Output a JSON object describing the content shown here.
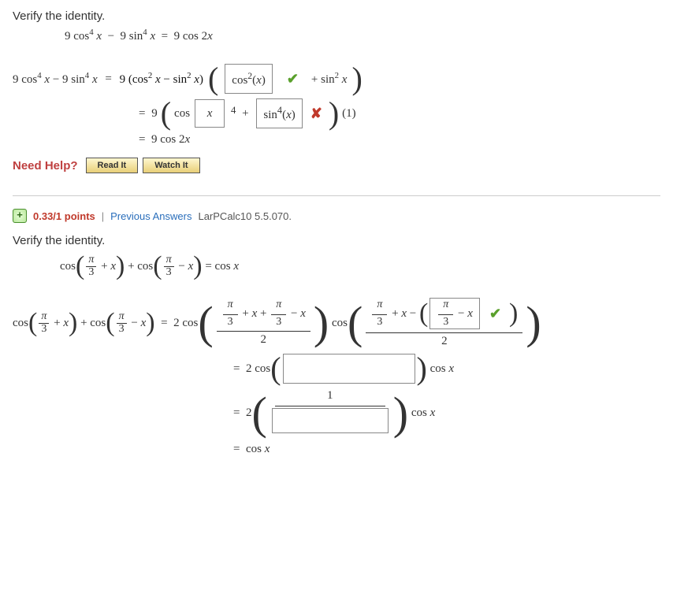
{
  "q1": {
    "prompt": "Verify the identity.",
    "identity_lhs": "9 cos⁴ x − 9 sin⁴ x",
    "identity_rhs": "9 cos 2x",
    "step1_left": "9 cos⁴ x − 9 sin⁴ x",
    "step1_right_prefix": "9 (cos² x − sin² x)",
    "input1_value": "cos²(x)",
    "input1_correct": true,
    "step1_suffix": "+ sin² x",
    "step2_prefix": "9",
    "step2_cosbox": "x",
    "step2_exp": "4",
    "step2_plus": "+",
    "input2_value": "sin⁴(x)",
    "input2_correct": false,
    "step2_suffix": "(1)",
    "step3": "9 cos 2x",
    "need_help": "Need Help?",
    "read_it": "Read It",
    "watch_it": "Watch It"
  },
  "q2": {
    "points": "0.33/1 points",
    "sep": "|",
    "prev": "Previous Answers",
    "source": "LarPCalc10 5.5.070.",
    "prompt": "Verify the identity.",
    "identity": "cos(π/3 + x) + cos(π/3 − x) = cos x",
    "lhs_text": "cos(π/3 + x) + cos(π/3 − x)",
    "eq": "=",
    "line1_pre": "2 cos",
    "line1_num_boxed": "π/3 − x",
    "line1_correct": true,
    "line2_pre": "2 cos",
    "line2_post": "cos x",
    "line3_pre": "2",
    "line3_num": "1",
    "line3_post": "cos x",
    "line4": "cos x"
  },
  "icons": {
    "plus": "+",
    "check": "✔",
    "cross": "✘"
  }
}
